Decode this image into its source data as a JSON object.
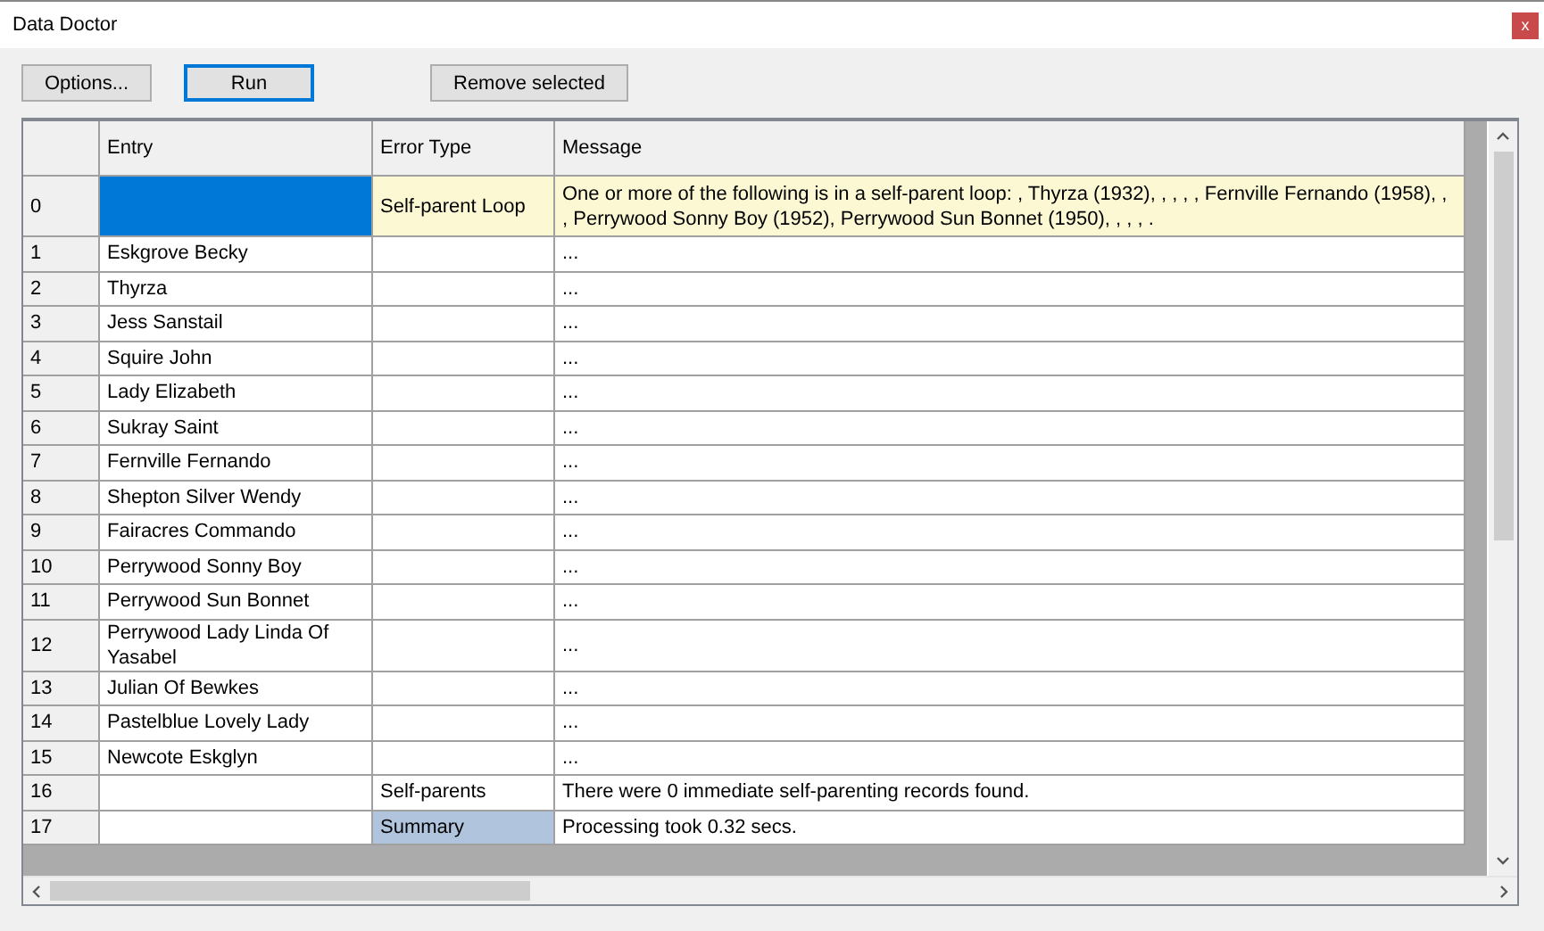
{
  "window": {
    "title": "Data Doctor",
    "close": "x"
  },
  "buttons": [
    {
      "label": "Options...",
      "focused": false
    },
    {
      "label": "Run",
      "focused": true
    },
    {
      "label": "Remove selected",
      "focused": false
    }
  ],
  "table": {
    "columns": [
      "Entry",
      "Error Type",
      "Message"
    ],
    "rows": [
      {
        "number": "0",
        "entry": "",
        "error_type": "Self-parent Loop",
        "message": "One or more of the following is in a self-parent loop: , Thyrza (1932), , , , , Fernville Fernando (1958), , , Perrywood Sonny Boy (1952), Perrywood Sun Bonnet (1950), , , , .",
        "kind": "loop",
        "selected": true
      },
      {
        "number": "1",
        "entry": "Eskgrove Becky",
        "message": "...",
        "kind": "plain",
        "selected": false
      },
      {
        "number": "2",
        "entry": "Thyrza",
        "message": "...",
        "kind": "plain",
        "selected": false
      },
      {
        "number": "3",
        "entry": "Jess Sanstail",
        "message": "...",
        "kind": "plain",
        "selected": false
      },
      {
        "number": "4",
        "entry": "Squire John",
        "message": "...",
        "kind": "plain",
        "selected": false
      },
      {
        "number": "5",
        "entry": "Lady Elizabeth",
        "message": "...",
        "kind": "plain",
        "selected": false
      },
      {
        "number": "6",
        "entry": "Sukray Saint",
        "message": "...",
        "kind": "plain",
        "selected": false
      },
      {
        "number": "7",
        "entry": "Fernville Fernando",
        "message": "...",
        "kind": "plain",
        "selected": false
      },
      {
        "number": "8",
        "entry": "Shepton Silver Wendy",
        "message": "...",
        "kind": "plain",
        "selected": false
      },
      {
        "number": "9",
        "entry": "Fairacres Commando",
        "message": "...",
        "kind": "plain",
        "selected": false
      },
      {
        "number": "10",
        "entry": "Perrywood Sonny Boy",
        "message": "...",
        "kind": "plain",
        "selected": false
      },
      {
        "number": "11",
        "entry": "Perrywood Sun Bonnet",
        "message": "...",
        "kind": "plain",
        "selected": false
      },
      {
        "number": "12",
        "entry": "Perrywood Lady Linda Of Yasabel",
        "message": "...",
        "kind": "plain",
        "selected": false
      },
      {
        "number": "13",
        "entry": "Julian Of Bewkes",
        "message": "...",
        "kind": "plain",
        "selected": false
      },
      {
        "number": "14",
        "entry": "Pastelblue Lovely Lady",
        "message": "...",
        "kind": "plain",
        "selected": false
      },
      {
        "number": "15",
        "entry": "Newcote Eskglyn",
        "message": "...",
        "kind": "plain",
        "selected": false
      },
      {
        "number": "16",
        "entry": "",
        "error_type": "Self-parents",
        "message": "There were 0 immediate self-parenting records found.",
        "kind": "plain",
        "selected": false
      },
      {
        "number": "17",
        "entry": "",
        "error_type": "Summary",
        "message": "Processing took 0.32 secs.",
        "kind": "summary",
        "selected": false
      }
    ]
  }
}
